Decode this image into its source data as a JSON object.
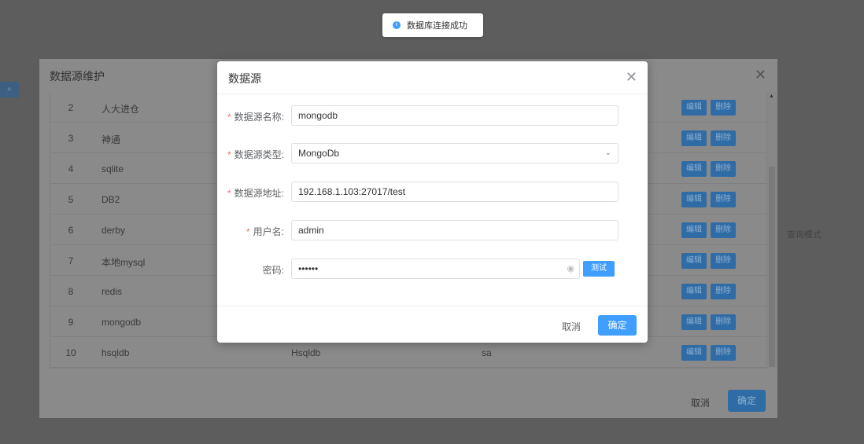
{
  "toast": {
    "text": "数据库连接成功",
    "icon": "info-icon"
  },
  "background": {
    "side_icon": "search-icon",
    "query_mode": "查询模式"
  },
  "outer_dialog": {
    "title": "数据源维护",
    "rows": [
      {
        "idx": "2",
        "name": "人大进仓",
        "type": "",
        "user": ""
      },
      {
        "idx": "3",
        "name": "神通",
        "type": "",
        "user": ""
      },
      {
        "idx": "4",
        "name": "sqlite",
        "type": "",
        "user": ""
      },
      {
        "idx": "5",
        "name": "DB2",
        "type": "",
        "user": ""
      },
      {
        "idx": "6",
        "name": "derby",
        "type": "",
        "user": ""
      },
      {
        "idx": "7",
        "name": "本地mysql",
        "type": "",
        "user": ""
      },
      {
        "idx": "8",
        "name": "redis",
        "type": "",
        "user": ""
      },
      {
        "idx": "9",
        "name": "mongodb",
        "type": "",
        "user": ""
      },
      {
        "idx": "10",
        "name": "hsqldb",
        "type": "Hsqldb",
        "user": "sa"
      }
    ],
    "edit_label": "编辑",
    "delete_label": "删除",
    "cancel": "取消",
    "ok": "确定"
  },
  "dialog": {
    "title": "数据源",
    "fields": {
      "name": {
        "label": "数据源名称:",
        "value": "mongodb"
      },
      "type": {
        "label": "数据源类型:",
        "value": "MongoDb"
      },
      "url": {
        "label": "数据源地址:",
        "value": "192.168.1.103:27017/test"
      },
      "user": {
        "label": "用户名:",
        "value": "admin"
      },
      "password": {
        "label": "密码:",
        "value": "••••••"
      }
    },
    "test": "测试",
    "cancel": "取消",
    "ok": "确定"
  }
}
